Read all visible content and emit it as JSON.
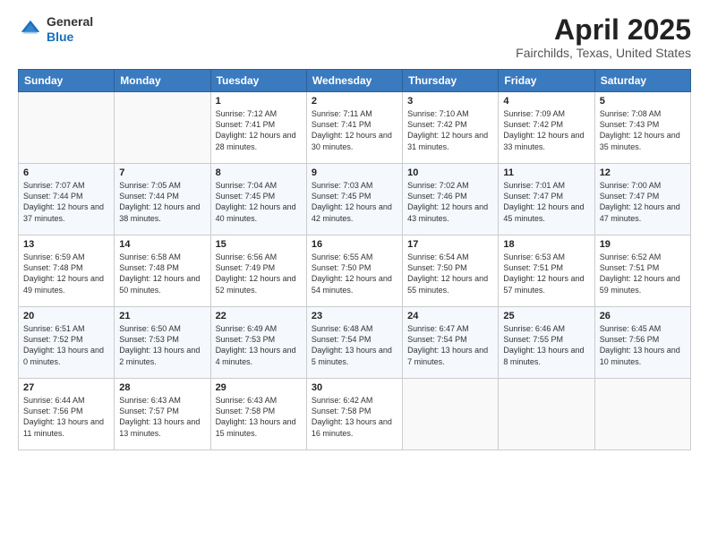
{
  "header": {
    "logo_general": "General",
    "logo_blue": "Blue",
    "title": "April 2025",
    "location": "Fairchilds, Texas, United States"
  },
  "days_of_week": [
    "Sunday",
    "Monday",
    "Tuesday",
    "Wednesday",
    "Thursday",
    "Friday",
    "Saturday"
  ],
  "weeks": [
    [
      {
        "day": "",
        "details": ""
      },
      {
        "day": "",
        "details": ""
      },
      {
        "day": "1",
        "sunrise": "Sunrise: 7:12 AM",
        "sunset": "Sunset: 7:41 PM",
        "daylight": "Daylight: 12 hours and 28 minutes."
      },
      {
        "day": "2",
        "sunrise": "Sunrise: 7:11 AM",
        "sunset": "Sunset: 7:41 PM",
        "daylight": "Daylight: 12 hours and 30 minutes."
      },
      {
        "day": "3",
        "sunrise": "Sunrise: 7:10 AM",
        "sunset": "Sunset: 7:42 PM",
        "daylight": "Daylight: 12 hours and 31 minutes."
      },
      {
        "day": "4",
        "sunrise": "Sunrise: 7:09 AM",
        "sunset": "Sunset: 7:42 PM",
        "daylight": "Daylight: 12 hours and 33 minutes."
      },
      {
        "day": "5",
        "sunrise": "Sunrise: 7:08 AM",
        "sunset": "Sunset: 7:43 PM",
        "daylight": "Daylight: 12 hours and 35 minutes."
      }
    ],
    [
      {
        "day": "6",
        "sunrise": "Sunrise: 7:07 AM",
        "sunset": "Sunset: 7:44 PM",
        "daylight": "Daylight: 12 hours and 37 minutes."
      },
      {
        "day": "7",
        "sunrise": "Sunrise: 7:05 AM",
        "sunset": "Sunset: 7:44 PM",
        "daylight": "Daylight: 12 hours and 38 minutes."
      },
      {
        "day": "8",
        "sunrise": "Sunrise: 7:04 AM",
        "sunset": "Sunset: 7:45 PM",
        "daylight": "Daylight: 12 hours and 40 minutes."
      },
      {
        "day": "9",
        "sunrise": "Sunrise: 7:03 AM",
        "sunset": "Sunset: 7:45 PM",
        "daylight": "Daylight: 12 hours and 42 minutes."
      },
      {
        "day": "10",
        "sunrise": "Sunrise: 7:02 AM",
        "sunset": "Sunset: 7:46 PM",
        "daylight": "Daylight: 12 hours and 43 minutes."
      },
      {
        "day": "11",
        "sunrise": "Sunrise: 7:01 AM",
        "sunset": "Sunset: 7:47 PM",
        "daylight": "Daylight: 12 hours and 45 minutes."
      },
      {
        "day": "12",
        "sunrise": "Sunrise: 7:00 AM",
        "sunset": "Sunset: 7:47 PM",
        "daylight": "Daylight: 12 hours and 47 minutes."
      }
    ],
    [
      {
        "day": "13",
        "sunrise": "Sunrise: 6:59 AM",
        "sunset": "Sunset: 7:48 PM",
        "daylight": "Daylight: 12 hours and 49 minutes."
      },
      {
        "day": "14",
        "sunrise": "Sunrise: 6:58 AM",
        "sunset": "Sunset: 7:48 PM",
        "daylight": "Daylight: 12 hours and 50 minutes."
      },
      {
        "day": "15",
        "sunrise": "Sunrise: 6:56 AM",
        "sunset": "Sunset: 7:49 PM",
        "daylight": "Daylight: 12 hours and 52 minutes."
      },
      {
        "day": "16",
        "sunrise": "Sunrise: 6:55 AM",
        "sunset": "Sunset: 7:50 PM",
        "daylight": "Daylight: 12 hours and 54 minutes."
      },
      {
        "day": "17",
        "sunrise": "Sunrise: 6:54 AM",
        "sunset": "Sunset: 7:50 PM",
        "daylight": "Daylight: 12 hours and 55 minutes."
      },
      {
        "day": "18",
        "sunrise": "Sunrise: 6:53 AM",
        "sunset": "Sunset: 7:51 PM",
        "daylight": "Daylight: 12 hours and 57 minutes."
      },
      {
        "day": "19",
        "sunrise": "Sunrise: 6:52 AM",
        "sunset": "Sunset: 7:51 PM",
        "daylight": "Daylight: 12 hours and 59 minutes."
      }
    ],
    [
      {
        "day": "20",
        "sunrise": "Sunrise: 6:51 AM",
        "sunset": "Sunset: 7:52 PM",
        "daylight": "Daylight: 13 hours and 0 minutes."
      },
      {
        "day": "21",
        "sunrise": "Sunrise: 6:50 AM",
        "sunset": "Sunset: 7:53 PM",
        "daylight": "Daylight: 13 hours and 2 minutes."
      },
      {
        "day": "22",
        "sunrise": "Sunrise: 6:49 AM",
        "sunset": "Sunset: 7:53 PM",
        "daylight": "Daylight: 13 hours and 4 minutes."
      },
      {
        "day": "23",
        "sunrise": "Sunrise: 6:48 AM",
        "sunset": "Sunset: 7:54 PM",
        "daylight": "Daylight: 13 hours and 5 minutes."
      },
      {
        "day": "24",
        "sunrise": "Sunrise: 6:47 AM",
        "sunset": "Sunset: 7:54 PM",
        "daylight": "Daylight: 13 hours and 7 minutes."
      },
      {
        "day": "25",
        "sunrise": "Sunrise: 6:46 AM",
        "sunset": "Sunset: 7:55 PM",
        "daylight": "Daylight: 13 hours and 8 minutes."
      },
      {
        "day": "26",
        "sunrise": "Sunrise: 6:45 AM",
        "sunset": "Sunset: 7:56 PM",
        "daylight": "Daylight: 13 hours and 10 minutes."
      }
    ],
    [
      {
        "day": "27",
        "sunrise": "Sunrise: 6:44 AM",
        "sunset": "Sunset: 7:56 PM",
        "daylight": "Daylight: 13 hours and 11 minutes."
      },
      {
        "day": "28",
        "sunrise": "Sunrise: 6:43 AM",
        "sunset": "Sunset: 7:57 PM",
        "daylight": "Daylight: 13 hours and 13 minutes."
      },
      {
        "day": "29",
        "sunrise": "Sunrise: 6:43 AM",
        "sunset": "Sunset: 7:58 PM",
        "daylight": "Daylight: 13 hours and 15 minutes."
      },
      {
        "day": "30",
        "sunrise": "Sunrise: 6:42 AM",
        "sunset": "Sunset: 7:58 PM",
        "daylight": "Daylight: 13 hours and 16 minutes."
      },
      {
        "day": "",
        "details": ""
      },
      {
        "day": "",
        "details": ""
      },
      {
        "day": "",
        "details": ""
      }
    ]
  ]
}
